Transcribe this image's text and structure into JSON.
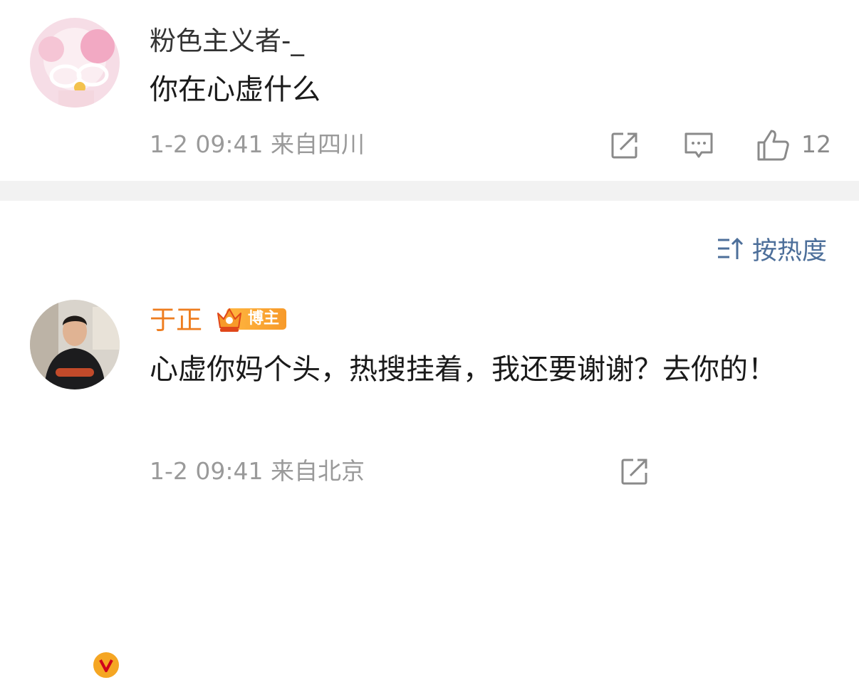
{
  "comments": [
    {
      "username": "粉色主义者-_",
      "content": "你在心虚什么",
      "timestamp": "1-2 09:41",
      "location": "来自四川",
      "like_count": "12"
    },
    {
      "username": "于正",
      "badge_label": "博主",
      "content": "心虚你妈个头，热搜挂着，我还要谢谢？去你的！",
      "timestamp": "1-2 09:41",
      "location": "来自北京"
    }
  ],
  "sort": {
    "label": "按热度"
  },
  "colors": {
    "username_highlight": "#ee7d1f",
    "link_blue": "#4d6f9a",
    "meta_gray": "#9a9a9a",
    "badge_orange": "#f79a2a"
  },
  "icons": [
    "share-icon",
    "reply-icon",
    "like-icon",
    "sort-icon",
    "crown-icon",
    "verified-icon"
  ]
}
